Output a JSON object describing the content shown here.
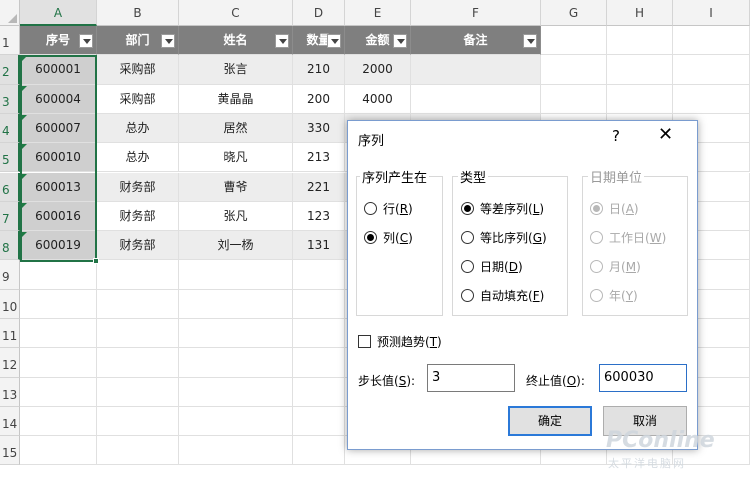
{
  "spreadsheet": {
    "columns": [
      "A",
      "B",
      "C",
      "D",
      "E",
      "F",
      "G",
      "H",
      "I"
    ],
    "rows": [
      "1",
      "2",
      "3",
      "4",
      "5",
      "6",
      "7",
      "8",
      "9",
      "10",
      "11",
      "12",
      "13",
      "14",
      "15"
    ],
    "selected_column": "A",
    "header_row": [
      "序号",
      "部门",
      "姓名",
      "数量",
      "金额",
      "备注"
    ],
    "data_rows": [
      [
        "600001",
        "采购部",
        "张言",
        "210",
        "2000",
        ""
      ],
      [
        "600004",
        "采购部",
        "黄晶晶",
        "200",
        "4000",
        ""
      ],
      [
        "600007",
        "总办",
        "居然",
        "330",
        "",
        ""
      ],
      [
        "600010",
        "总办",
        "晓凡",
        "213",
        "",
        ""
      ],
      [
        "600013",
        "财务部",
        "曹爷",
        "221",
        "",
        ""
      ],
      [
        "600016",
        "财务部",
        "张凡",
        "123",
        "",
        ""
      ],
      [
        "600019",
        "财务部",
        "刘一杨",
        "131",
        "",
        ""
      ]
    ],
    "colors": {
      "table_header": "#7f7f7f",
      "band": "#ededed",
      "selection": "#217346"
    }
  },
  "dialog": {
    "title": "序列",
    "help_label": "?",
    "close_label": "✕",
    "series_in": {
      "title": "序列产生在",
      "options": [
        {
          "label": "行",
          "key": "R",
          "checked": false
        },
        {
          "label": "列",
          "key": "C",
          "checked": true
        }
      ]
    },
    "type": {
      "title": "类型",
      "options": [
        {
          "label": "等差序列",
          "key": "L",
          "checked": true
        },
        {
          "label": "等比序列",
          "key": "G",
          "checked": false
        },
        {
          "label": "日期",
          "key": "D",
          "checked": false
        },
        {
          "label": "自动填充",
          "key": "F",
          "checked": false
        }
      ]
    },
    "date_unit": {
      "title": "日期单位",
      "options": [
        {
          "label": "日",
          "key": "A",
          "checked": true
        },
        {
          "label": "工作日",
          "key": "W",
          "checked": false
        },
        {
          "label": "月",
          "key": "M",
          "checked": false
        },
        {
          "label": "年",
          "key": "Y",
          "checked": false
        }
      ]
    },
    "trend": {
      "label": "预测趋势",
      "key": "T",
      "checked": false
    },
    "step": {
      "label": "步长值",
      "key": "S",
      "value": "3"
    },
    "stop": {
      "label": "终止值",
      "key": "O",
      "value": "600030"
    },
    "ok_label": "确定",
    "cancel_label": "取消"
  },
  "watermark": {
    "line1": "PConline",
    "line2": "太平洋电脑网"
  }
}
